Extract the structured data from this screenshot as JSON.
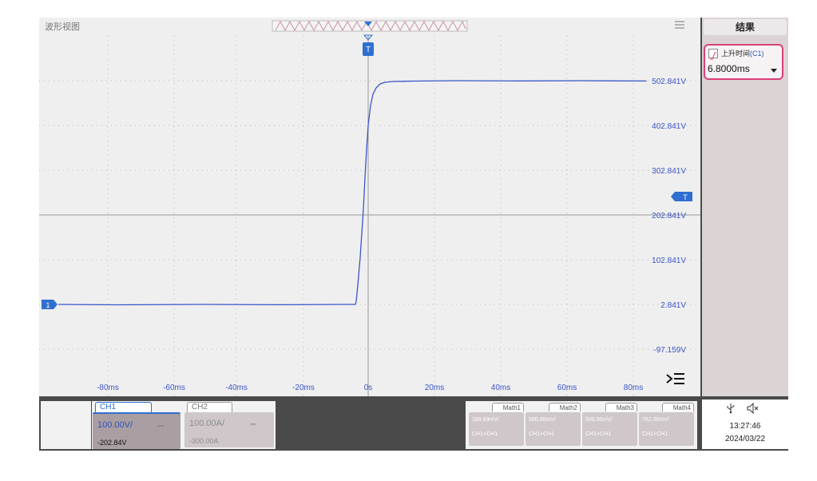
{
  "waveform": {
    "title": "波形视图",
    "trigger_marker": "T",
    "channel_marker": "1",
    "y_labels": [
      "502.841V",
      "402.841V",
      "302.841V",
      "202.841V",
      "102.841V",
      "2.841V",
      "-97.159V"
    ],
    "x_labels": [
      "-80ms",
      "-60ms",
      "-40ms",
      "-20ms",
      "0s",
      "20ms",
      "40ms",
      "60ms",
      "80ms"
    ]
  },
  "results": {
    "header": "结果",
    "measurement": {
      "label": "上升时间",
      "source": "(C1)",
      "value": "6.8000ms"
    }
  },
  "channels": [
    {
      "name": "CH1",
      "scale": "100.00V/",
      "coupling": "⎓",
      "offset": "-202.84V",
      "active": true
    },
    {
      "name": "CH2",
      "scale": "100.00A/",
      "coupling": "⎓",
      "offset": "-300.00A",
      "active": false
    }
  ],
  "math": [
    {
      "name": "Math1",
      "scale": "189.69mV/",
      "expr": "CH1+CH1"
    },
    {
      "name": "Math2",
      "scale": "500.00mV/",
      "expr": "CH1+CH1"
    },
    {
      "name": "Math3",
      "scale": "500.00mV/",
      "expr": "CH1+CH1"
    },
    {
      "name": "Math4",
      "scale": "762.00mV/",
      "expr": "CH1+CH1"
    }
  ],
  "status": {
    "time": "13:27:46",
    "date": "2024/03/22"
  },
  "colors": {
    "trace": "#3b55c9",
    "accent": "#2f6fd0",
    "highlight": "#d8407a"
  }
}
